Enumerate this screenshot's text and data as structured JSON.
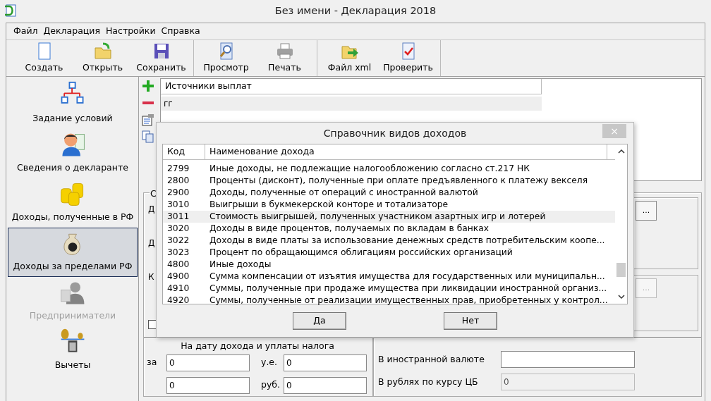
{
  "window": {
    "title": "Без имени - Декларация 2018"
  },
  "menu": [
    "Файл",
    "Декларация",
    "Настройки",
    "Справка"
  ],
  "toolbar": [
    [
      {
        "label": "Создать"
      },
      {
        "label": "Открыть"
      },
      {
        "label": "Сохранить"
      }
    ],
    [
      {
        "label": "Просмотр"
      },
      {
        "label": "Печать"
      }
    ],
    [
      {
        "label": "Файл xml"
      },
      {
        "label": "Проверить"
      }
    ]
  ],
  "sidebar": {
    "items": [
      {
        "label": "Задание условий",
        "selected": false,
        "disabled": false
      },
      {
        "label": "Сведения о декларанте",
        "selected": false,
        "disabled": false
      },
      {
        "label": "Доходы, полученные в РФ",
        "selected": false,
        "disabled": false
      },
      {
        "label": "Доходы за пределами РФ",
        "selected": true,
        "disabled": false
      },
      {
        "label": "Предприниматели",
        "selected": false,
        "disabled": true
      },
      {
        "label": "Вычеты",
        "selected": false,
        "disabled": false
      }
    ]
  },
  "sources": {
    "header": "Источники выплат",
    "rows": [
      "гг"
    ]
  },
  "form": {
    "group_label": "С",
    "row_labels": [
      "Д",
      "Д",
      "К"
    ],
    "checkbox": {
      "checked": false
    },
    "browse_buttons": [
      {
        "label": "...",
        "disabled": false
      },
      {
        "label": "...",
        "disabled": true
      }
    ],
    "left_group": {
      "title": "На дату дохода и уплаты налога",
      "fields": [
        {
          "label": "за",
          "value": "0"
        },
        {
          "label": "у.е.",
          "value": "0"
        },
        {
          "value": "0"
        },
        {
          "label": "руб.",
          "value": "0"
        }
      ]
    },
    "right_group": {
      "fields": [
        {
          "label": "В иностранной валюте",
          "disabled": false
        },
        {
          "label": "В рублях по курсу ЦБ",
          "value": "0",
          "disabled": true
        }
      ]
    }
  },
  "dialog": {
    "title": "Справочник видов доходов",
    "close": "×",
    "columns": [
      "Код",
      "Наименование дохода"
    ],
    "rows": [
      {
        "code": "2799",
        "name": "Иные доходы, не подлежащие налогообложению согласно ст.217 НК",
        "selected": false
      },
      {
        "code": "2800",
        "name": "Проценты (дисконт), полученные при оплате предъявленного к платежу векселя",
        "selected": false
      },
      {
        "code": "2900",
        "name": "Доходы, полученные от операций с иностранной валютой",
        "selected": false
      },
      {
        "code": "3010",
        "name": "Выигрыши в букмекерской конторе и тотализаторе",
        "selected": false
      },
      {
        "code": "3011",
        "name": "Стоимость выигрышей, полученных участником азартных игр и лотерей",
        "selected": true
      },
      {
        "code": "3020",
        "name": "Доходы в виде процентов, получаемых по вкладам в банках",
        "selected": false
      },
      {
        "code": "3022",
        "name": "Доходы в виде платы за использование денежных средств потребительским коопе...",
        "selected": false
      },
      {
        "code": "3023",
        "name": "Процент по обращающимся облигациям российских организаций",
        "selected": false
      },
      {
        "code": "4800",
        "name": "Иные доходы",
        "selected": false
      },
      {
        "code": "4900",
        "name": "Сумма компенсации от изъятия имущества для государственных или муниципальн...",
        "selected": false
      },
      {
        "code": "4910",
        "name": "Суммы, полученные при продаже имущества при ликвидации иностранной организ...",
        "selected": false
      },
      {
        "code": "4920",
        "name": "Суммы, полученные от реализации имущественных прав, приобретенных у контрол...",
        "selected": false
      }
    ],
    "buttons": [
      "Да",
      "Нет"
    ]
  }
}
